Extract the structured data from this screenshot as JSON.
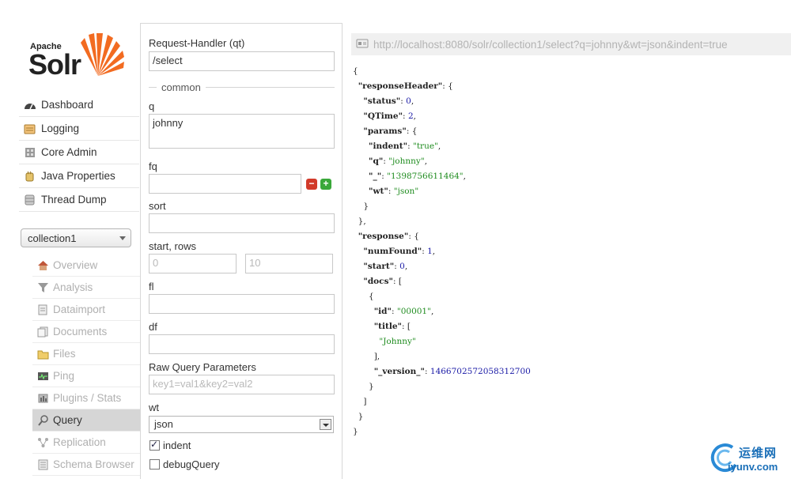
{
  "logo": {
    "apache": "Apache",
    "solr": "Solr"
  },
  "main_nav": [
    {
      "label": "Dashboard",
      "icon": "dashboard-icon"
    },
    {
      "label": "Logging",
      "icon": "logging-icon"
    },
    {
      "label": "Core Admin",
      "icon": "core-admin-icon"
    },
    {
      "label": "Java Properties",
      "icon": "java-properties-icon"
    },
    {
      "label": "Thread Dump",
      "icon": "thread-dump-icon"
    }
  ],
  "core_selector": {
    "selected": "collection1"
  },
  "core_nav": [
    {
      "label": "Overview",
      "icon": "home-icon",
      "active": false
    },
    {
      "label": "Analysis",
      "icon": "funnel-icon",
      "active": false
    },
    {
      "label": "Dataimport",
      "icon": "dataimport-icon",
      "active": false
    },
    {
      "label": "Documents",
      "icon": "documents-icon",
      "active": false
    },
    {
      "label": "Files",
      "icon": "folder-icon",
      "active": false
    },
    {
      "label": "Ping",
      "icon": "ping-icon",
      "active": false
    },
    {
      "label": "Plugins / Stats",
      "icon": "plugins-icon",
      "active": false
    },
    {
      "label": "Query",
      "icon": "magnifier-icon",
      "active": true
    },
    {
      "label": "Replication",
      "icon": "replication-icon",
      "active": false
    },
    {
      "label": "Schema Browser",
      "icon": "schema-icon",
      "active": false
    }
  ],
  "form": {
    "request_handler": {
      "label": "Request-Handler (qt)",
      "value": "/select"
    },
    "common_label": "common",
    "q": {
      "label": "q",
      "value": "johnny"
    },
    "fq": {
      "label": "fq",
      "value": ""
    },
    "sort": {
      "label": "sort",
      "value": ""
    },
    "start_rows": {
      "label": "start, rows",
      "start_placeholder": "0",
      "rows_placeholder": "10"
    },
    "fl": {
      "label": "fl",
      "value": ""
    },
    "df": {
      "label": "df",
      "value": ""
    },
    "raw": {
      "label": "Raw Query Parameters",
      "placeholder": "key1=val1&key2=val2"
    },
    "wt": {
      "label": "wt",
      "value": "json"
    },
    "indent": {
      "label": "indent",
      "checked": true
    },
    "debug": {
      "label": "debugQuery",
      "checked": false
    }
  },
  "results": {
    "url": "http://localhost:8080/solr/collection1/select?q=johnny&wt=json&indent=true",
    "status": "0",
    "qtime": "2",
    "params_indent": "\"true\"",
    "params_q": "\"johnny\"",
    "params_ts": "\"1398756611464\"",
    "params_wt": "\"json\"",
    "num_found": "1",
    "start": "0",
    "doc_id": "\"00001\"",
    "doc_title": "\"Johnny\"",
    "doc_version": "1466702572058312700"
  },
  "watermark": {
    "cn": "运维网",
    "en": "iyunv.com"
  },
  "colors": {
    "accent_orange": "#f26b21",
    "string_green": "#1f8c1f",
    "number_blue": "#1a1aa6",
    "active_bg": "#d6d6d6"
  }
}
